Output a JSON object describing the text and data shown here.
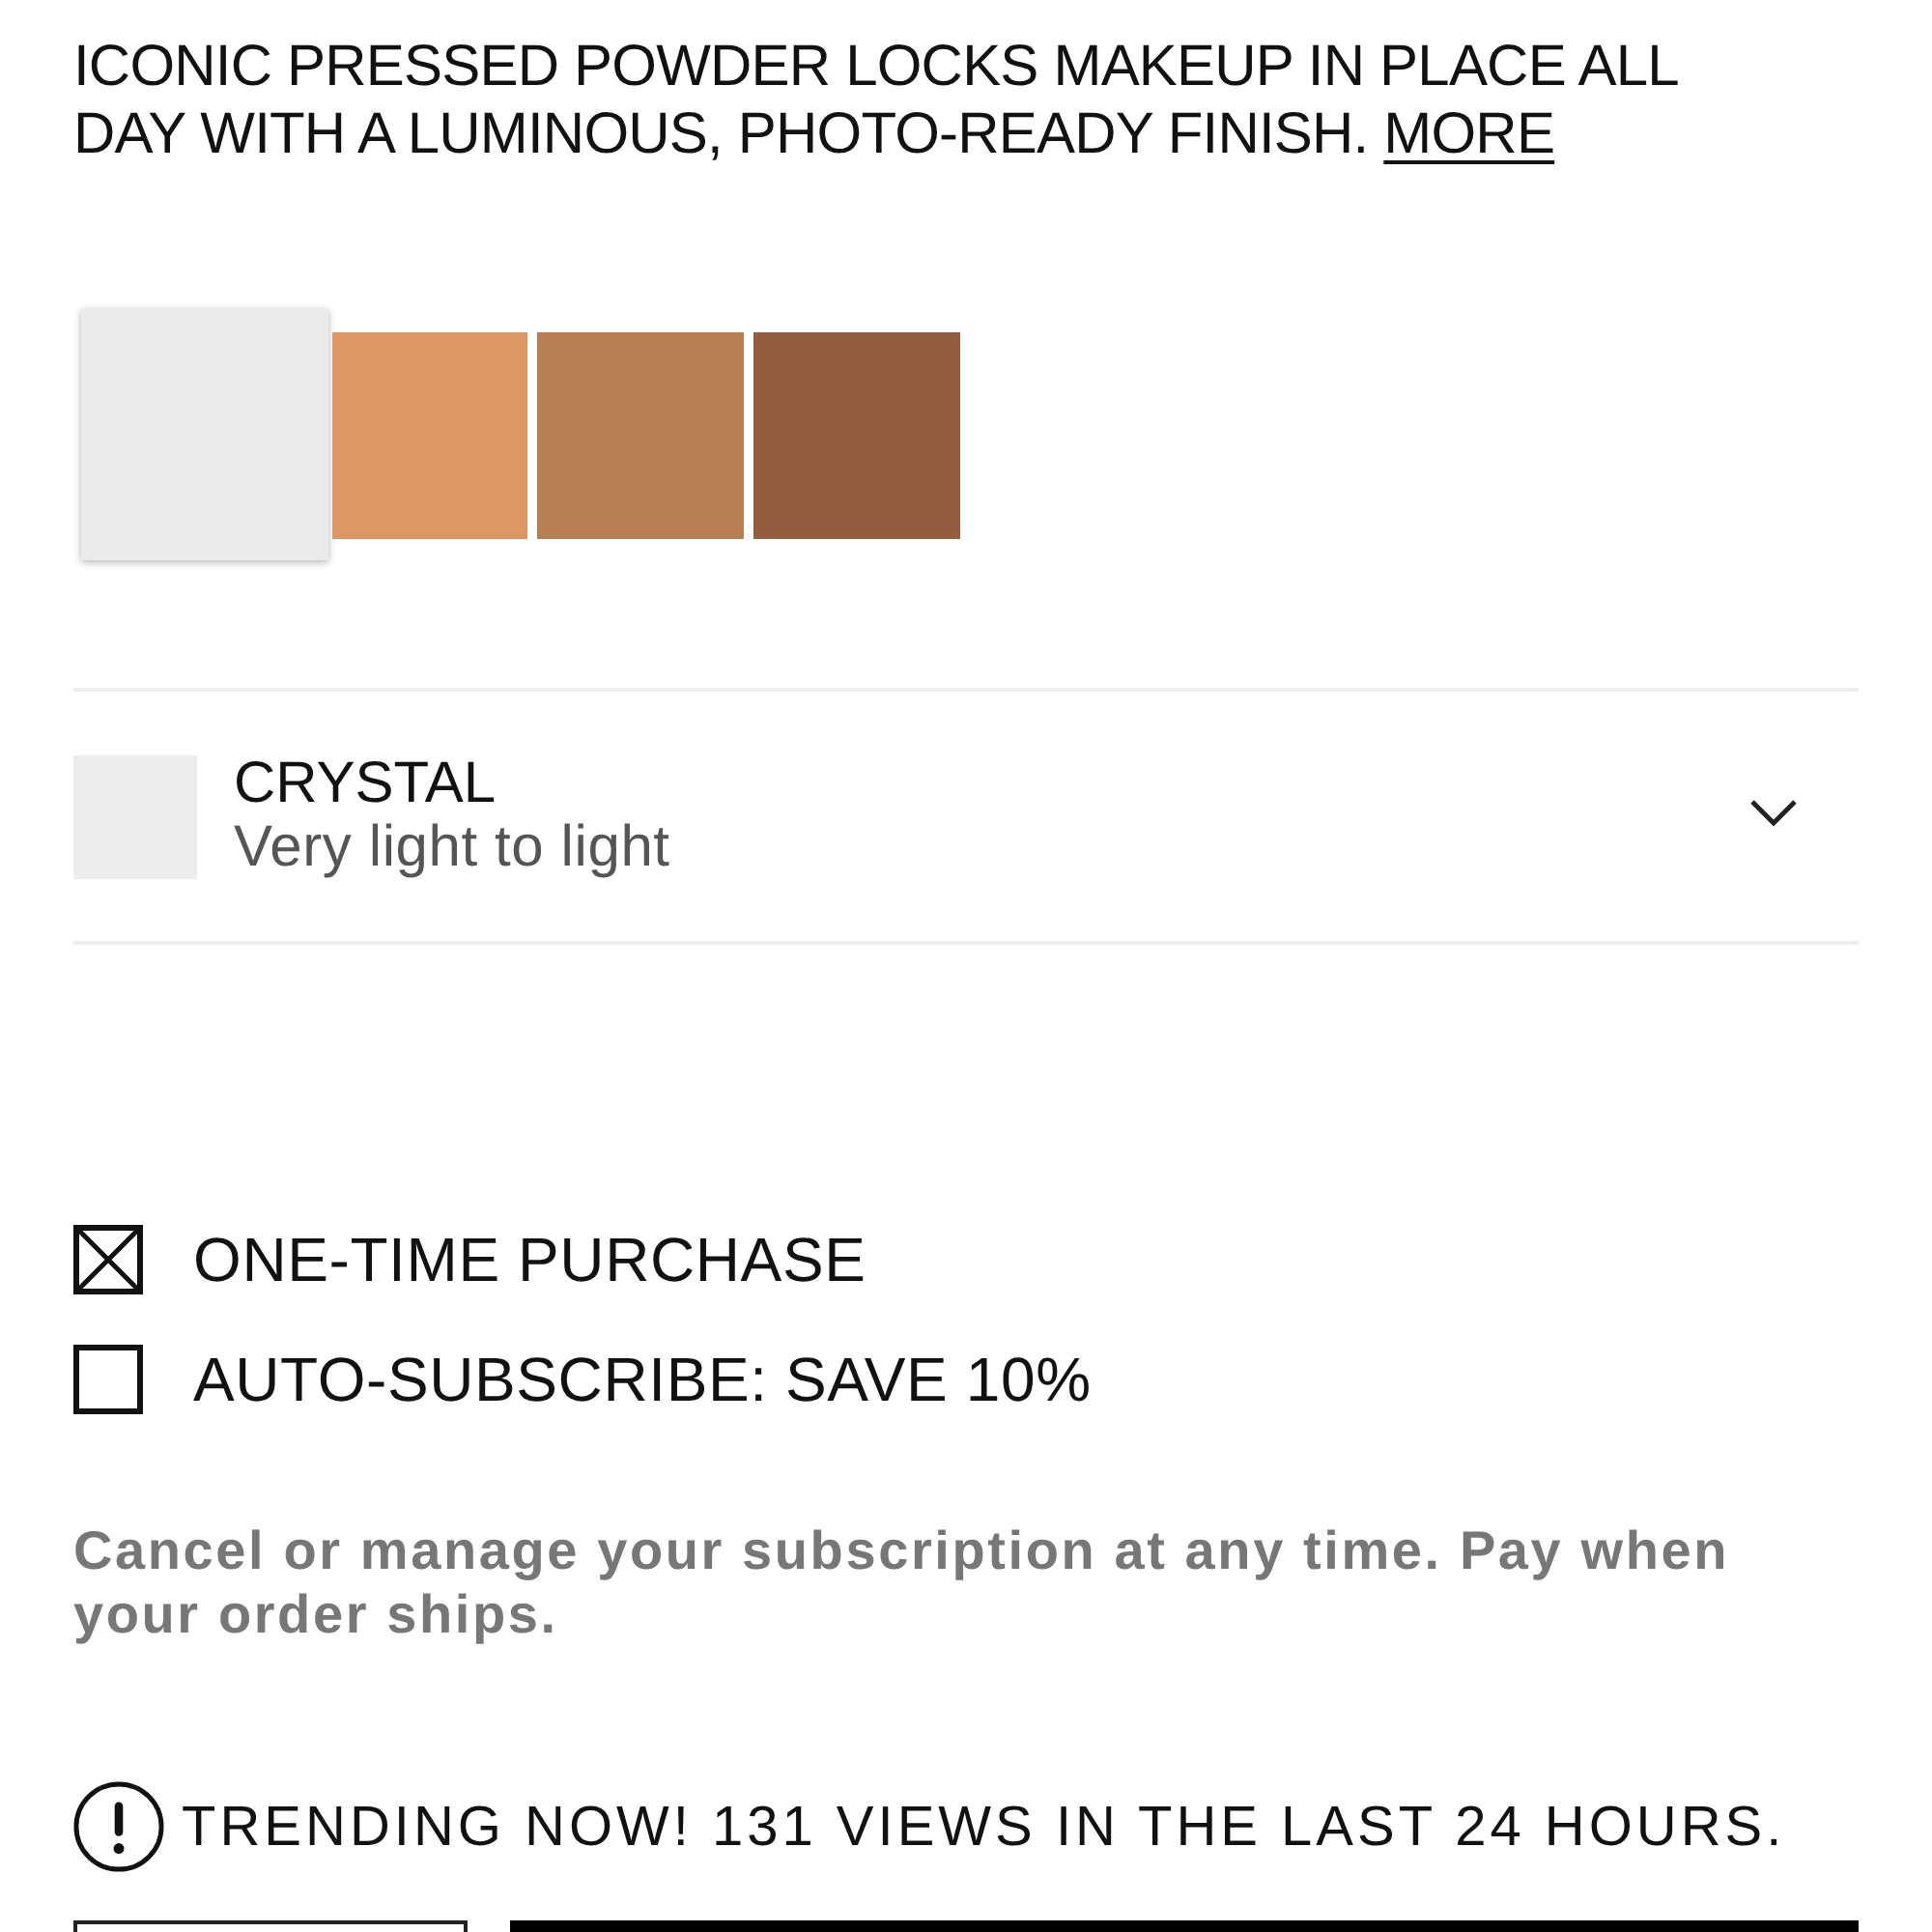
{
  "description": {
    "text": "ICONIC PRESSED POWDER LOCKS MAKEUP IN PLACE ALL DAY WITH A LUMINOUS, PHOTO-READY FINISH.",
    "link": "MORE"
  },
  "swatches": [
    {
      "color": "#ebebeb",
      "selected": true
    },
    {
      "color": "#dc9764",
      "selected": false
    },
    {
      "color": "#b67f54",
      "selected": false
    },
    {
      "color": "#935d3e",
      "selected": false
    }
  ],
  "shade_selector": {
    "color": "#ececec",
    "name": "CRYSTAL",
    "description": "Very light to light",
    "expanded": false
  },
  "purchase_options": [
    {
      "label": "ONE-TIME PURCHASE",
      "checked": true
    },
    {
      "label": "AUTO-SUBSCRIBE: SAVE 10%",
      "checked": false
    }
  ],
  "subscription_note": "Cancel or manage your subscription at any time. Pay when your order ships.",
  "trending": {
    "text": "TRENDING NOW! 131 VIEWS IN THE LAST 24 HOURS."
  }
}
